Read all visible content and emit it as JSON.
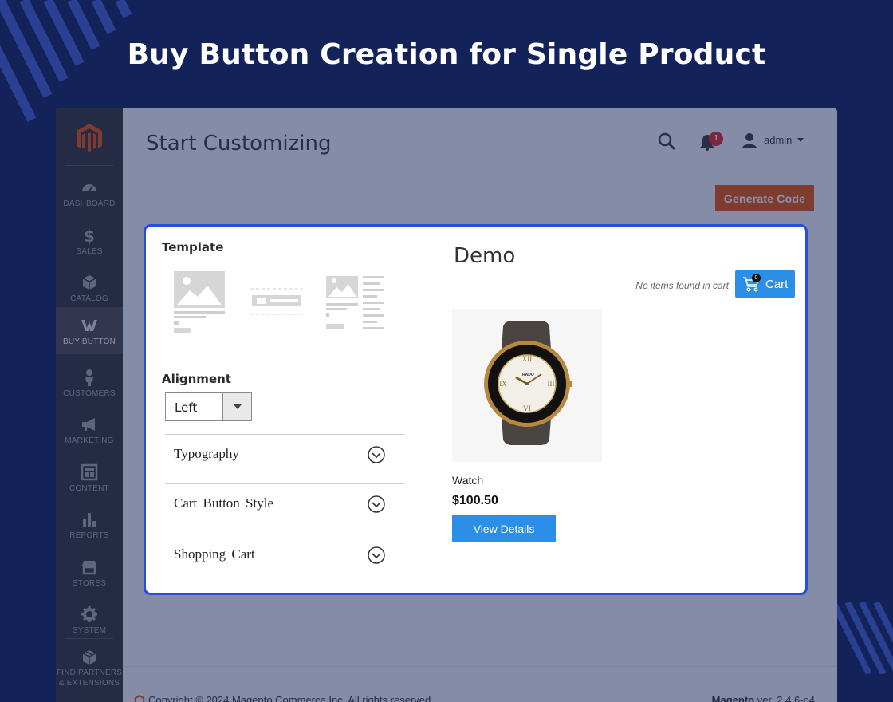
{
  "banner": {
    "title": "Buy Button Creation for Single Product"
  },
  "sidebar": {
    "items": [
      {
        "label": "DASHBOARD",
        "icon": "dashboard-icon"
      },
      {
        "label": "SALES",
        "icon": "dollar-icon"
      },
      {
        "label": "CATALOG",
        "icon": "cube-icon"
      },
      {
        "label": "BUY BUTTON",
        "icon": "buy-button-icon",
        "active": true
      },
      {
        "label": "CUSTOMERS",
        "icon": "person-icon"
      },
      {
        "label": "MARKETING",
        "icon": "megaphone-icon"
      },
      {
        "label": "CONTENT",
        "icon": "layout-icon"
      },
      {
        "label": "REPORTS",
        "icon": "bar-chart-icon"
      },
      {
        "label": "STORES",
        "icon": "store-icon"
      },
      {
        "label": "SYSTEM",
        "icon": "gear-icon"
      },
      {
        "label_line1": "FIND PARTNERS",
        "label_line2": "& EXTENSIONS",
        "icon": "partners-icon"
      }
    ]
  },
  "header": {
    "page_title": "Start Customizing",
    "notification_count": "1",
    "user_name": "admin",
    "generate_code_label": "Generate Code"
  },
  "footer": {
    "copyright": "Copyright © 2024 Magento Commerce Inc. All rights reserved.",
    "brand": "Magento",
    "version": " ver. 2.4.6-p4"
  },
  "customizer": {
    "template_title": "Template",
    "alignment_title": "Alignment",
    "alignment_value": "Left",
    "accordion": [
      {
        "label": "Typography"
      },
      {
        "label": "Cart Button Style"
      },
      {
        "label": "Shopping Cart"
      }
    ]
  },
  "demo": {
    "title": "Demo",
    "cart_status": "No items found in cart",
    "cart_count": "0",
    "cart_label": "Cart",
    "product_name": "Watch",
    "product_price": "$100.50",
    "view_details_label": "View Details",
    "watch_brand": "RADO"
  },
  "colors": {
    "background": "#13235a",
    "accent_orange": "#eb5202",
    "button_blue": "#2b8fe8",
    "modal_border": "#2450e0",
    "sidebar": "#373330"
  }
}
